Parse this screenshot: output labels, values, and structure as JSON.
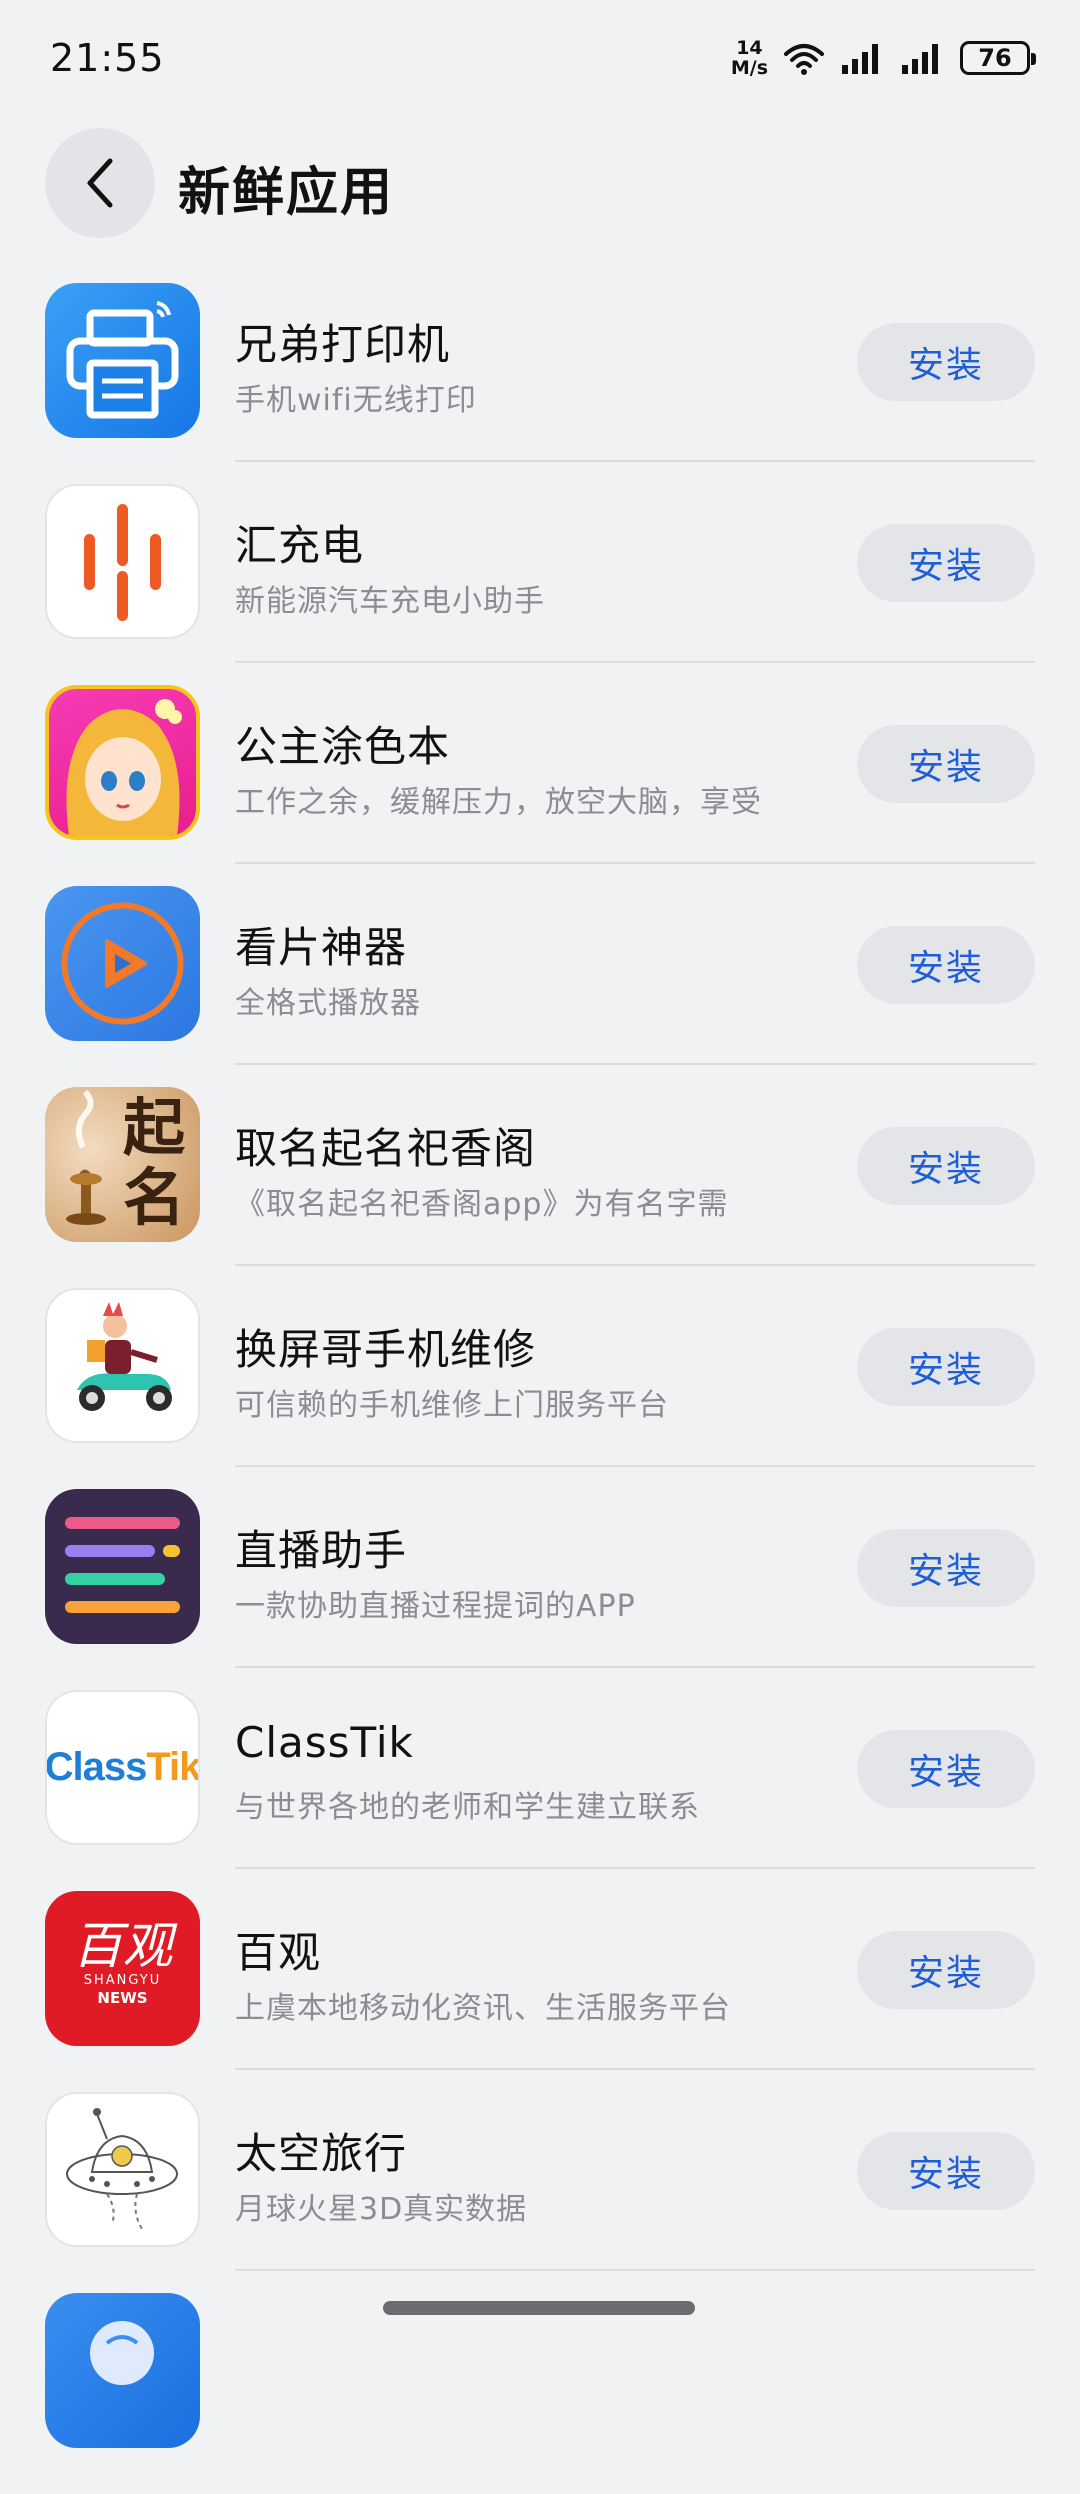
{
  "status_bar": {
    "time": "21:55",
    "net_speed_value": "14",
    "net_speed_unit": "M/s",
    "battery": "76"
  },
  "header": {
    "title": "新鲜应用"
  },
  "apps": [
    {
      "name": "兄弟打印机",
      "desc": "手机wifi无线打印",
      "button": "安装"
    },
    {
      "name": "汇充电",
      "desc": "新能源汽车充电小助手",
      "button": "安装"
    },
    {
      "name": "公主涂色本",
      "desc": "工作之余，缓解压力，放空大脑，享受",
      "button": "安装"
    },
    {
      "name": "看片神器",
      "desc": "全格式播放器",
      "button": "安装"
    },
    {
      "name": "取名起名祀香阁",
      "desc": "《取名起名祀香阁app》为有名字需",
      "button": "安装",
      "icon_text": "起名"
    },
    {
      "name": "换屏哥手机维修",
      "desc": "可信赖的手机维修上门服务平台",
      "button": "安装"
    },
    {
      "name": "直播助手",
      "desc": "一款协助直播过程提词的APP",
      "button": "安装"
    },
    {
      "name": "ClassTik",
      "desc": "与世界各地的老师和学生建立联系",
      "button": "安装",
      "icon_text_a": "Class",
      "icon_text_b": "Tik"
    },
    {
      "name": "百观",
      "desc": "上虞本地移动化资讯、生活服务平台",
      "button": "安装",
      "icon_text": "百观",
      "icon_sub1": "SHANGYU",
      "icon_sub2": "NEWS"
    },
    {
      "name": "太空旅行",
      "desc": "月球火星3D真实数据",
      "button": "安装"
    }
  ]
}
